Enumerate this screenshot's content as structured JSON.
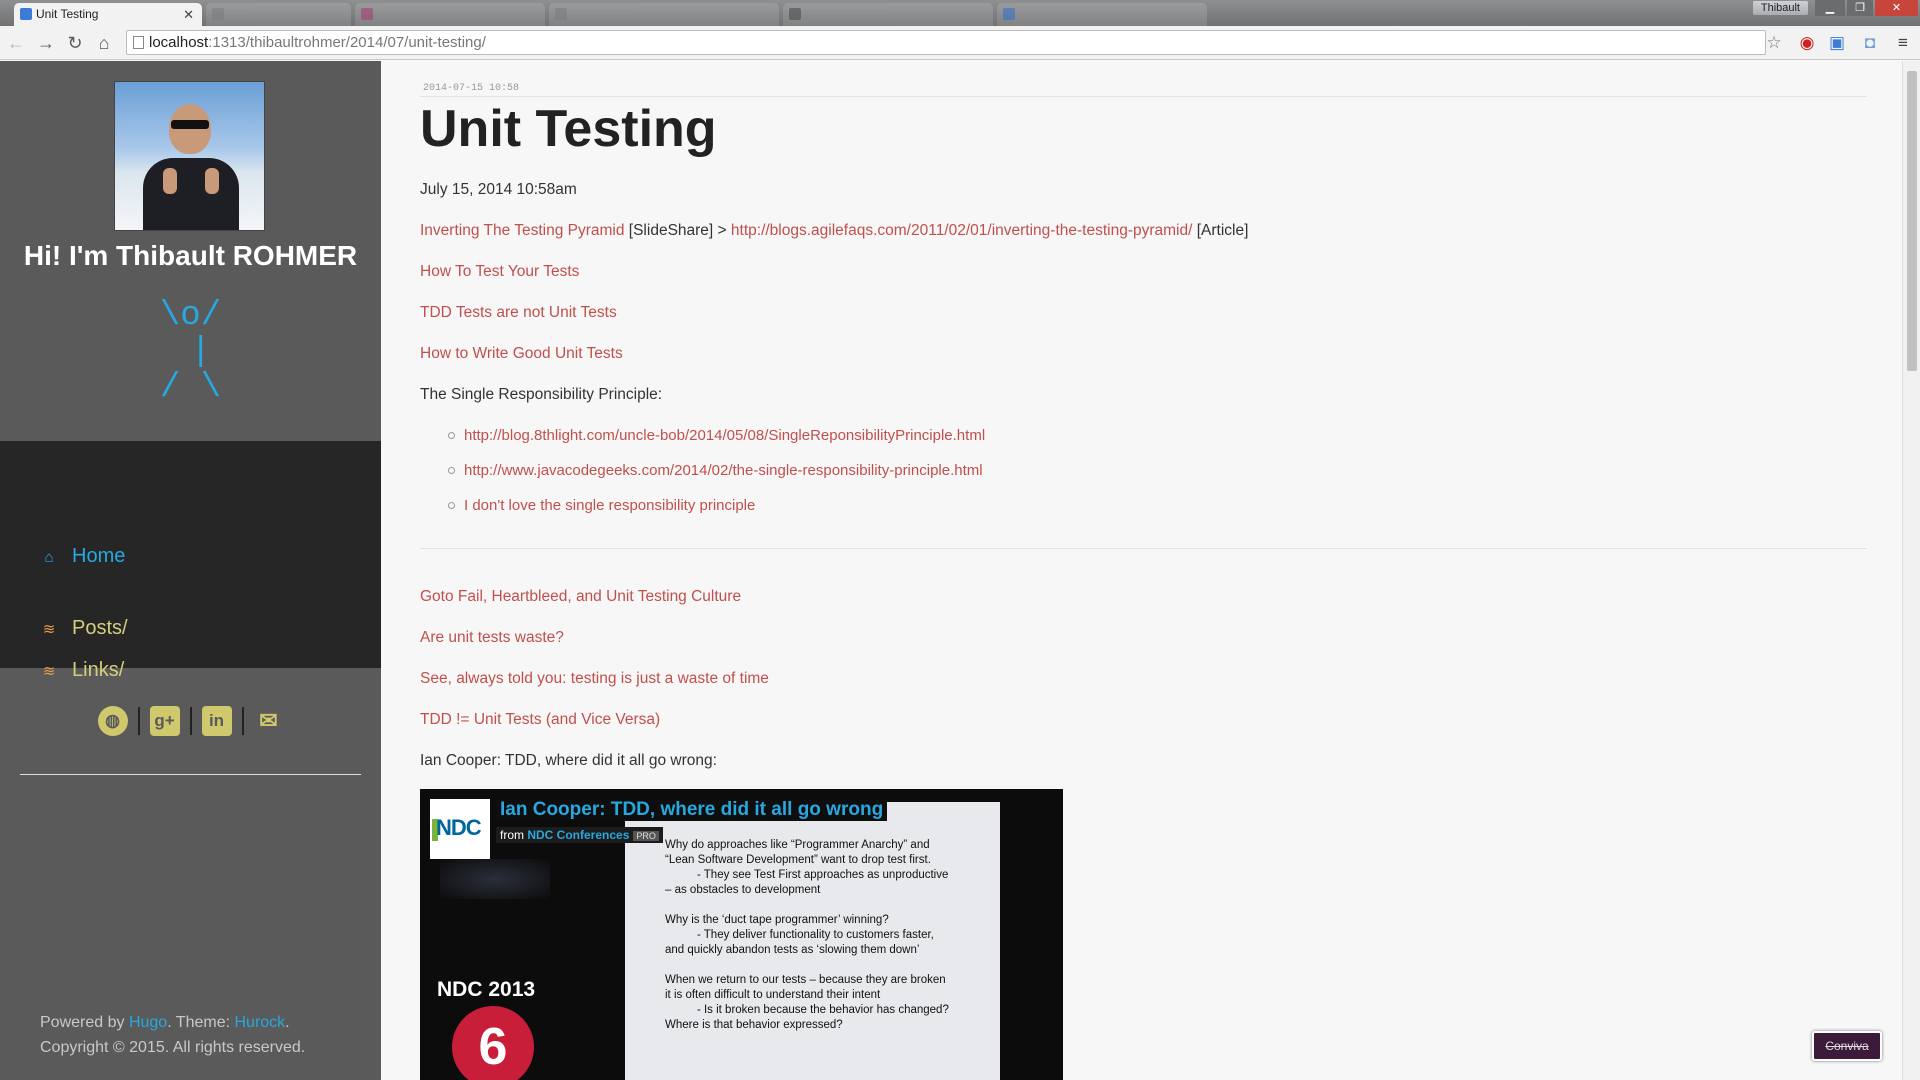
{
  "browser": {
    "tabs": [
      {
        "title": "Unit Testing",
        "active": true
      },
      {
        "title": "",
        "active": false
      },
      {
        "title": "",
        "active": false
      },
      {
        "title": "",
        "active": false
      },
      {
        "title": "",
        "active": false
      },
      {
        "title": "",
        "active": false
      }
    ],
    "profile_name": "Thibault",
    "url_host": "localhost",
    "url_rest": ":1313/thibaultrohmer/2014/07/unit-testing/",
    "colors": {
      "chrome": "#f2f2f2",
      "tabbar": "#7e8082"
    }
  },
  "sidebar": {
    "greeting": "Hi! I'm Thibault ROHMER",
    "stickman": "\\o/\n |\n/ \\",
    "nav": {
      "home": "Home",
      "posts": "Posts/",
      "links": "Links/"
    },
    "social_icons": [
      "github-icon",
      "google-plus-icon",
      "linkedin-icon",
      "mail-icon"
    ],
    "footer": {
      "powered_by": "Powered by ",
      "hugo": "Hugo",
      "theme_label": ". Theme: ",
      "theme": "Hurock",
      "theme_end": ".",
      "copyright": "Copyright © 2015. All rights reserved."
    },
    "colors": {
      "background": "#5a5a5a",
      "nav_bg": "#262626",
      "accent": "#27a8e0",
      "link": "#d6ce7c"
    }
  },
  "article": {
    "timestamp": "2014-07-15 10:58",
    "title": "Unit Testing",
    "date": "July 15, 2014 10:58am",
    "p1": {
      "link1": "Inverting The Testing Pyramid",
      "text1": " [SlideShare] > ",
      "link2": "http://blogs.agilefaqs.com/2011/02/01/inverting-the-testing-pyramid/",
      "text2": " [Article]"
    },
    "links_a": [
      "How To Test Your Tests",
      "TDD Tests are not Unit Tests",
      "How to Write Good Unit Tests"
    ],
    "srp_label": "The Single Responsibility Principle:",
    "srp_items": [
      "http://blog.8thlight.com/uncle-bob/2014/05/08/SingleReponsibilityPrinciple.html",
      "http://www.javacodegeeks.com/2014/02/the-single-responsibility-principle.html",
      "I don't love the single responsibility principle"
    ],
    "links_b": [
      "Goto Fail, Heartbleed, and Unit Testing Culture",
      "Are unit tests waste?",
      "See, always told you: testing is just a waste of time",
      "TDD != Unit Tests (and Vice Versa)"
    ],
    "video_label": "Ian Cooper: TDD, where did it all go wrong:",
    "colors": {
      "link": "#c0504d",
      "text": "#333333"
    }
  },
  "video": {
    "title": "Ian Cooper: TDD, where did it all go wrong",
    "from": "from ",
    "channel": "NDC Conferences",
    "badge": "PRO",
    "logo": "NDC",
    "event": "NDC 2013",
    "day": "6",
    "slide_text": "Why do approaches like “Programmer Anarchy” and\n“Lean Software Development” want to drop test first.\n          - They see Test First approaches as unproductive\n– as obstacles to development\n\nWhy is the ‘duct tape programmer’ winning?\n          - They deliver functionality to customers faster,\nand quickly abandon tests as ‘slowing them down’\n\nWhen we return to our tests – because they are broken\nit is often difficult to understand their intent\n          - Is it broken because the behavior has changed?\nWhere is that behavior expressed?"
  },
  "extension_popup": {
    "label": "Conviva"
  }
}
